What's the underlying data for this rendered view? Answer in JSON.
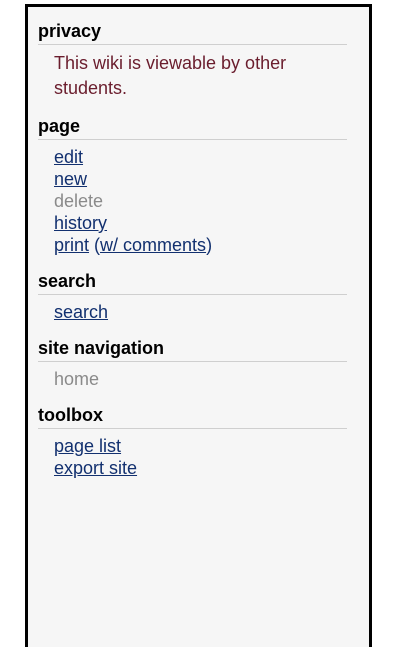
{
  "privacy": {
    "title": "privacy",
    "text": "This wiki is viewable by other students."
  },
  "page": {
    "title": "page",
    "edit": "edit",
    "new": "new",
    "delete": "delete",
    "history": "history",
    "print": "print",
    "print_paren_open": "(",
    "with_comments": "w/ comments",
    "print_paren_close": ")"
  },
  "search": {
    "title": "search",
    "link": "search"
  },
  "site_navigation": {
    "title": "site navigation",
    "home": "home"
  },
  "toolbox": {
    "title": "toolbox",
    "page_list": "page list",
    "export_site": "export site"
  },
  "colors": {
    "link": "#12306f",
    "privacy_text": "#6a1d2d",
    "disabled": "#8a8a8a",
    "panel_bg": "#f6f6f6"
  }
}
